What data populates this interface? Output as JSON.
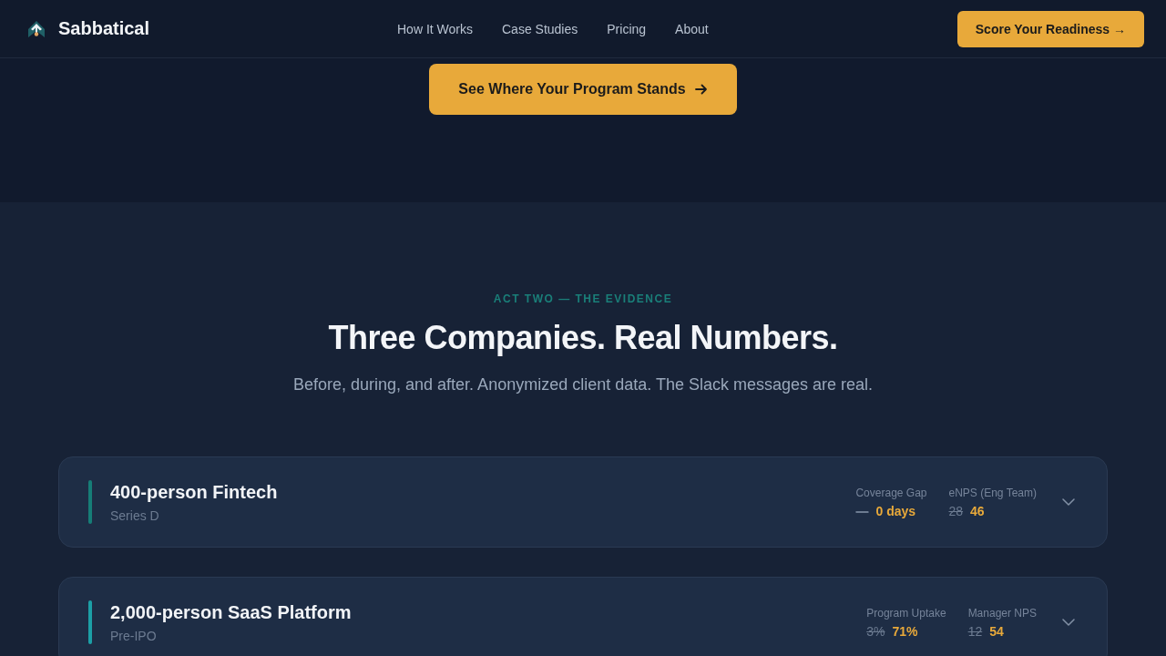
{
  "header": {
    "brand": "Sabbatical",
    "nav": [
      "How It Works",
      "Case Studies",
      "Pricing",
      "About"
    ],
    "cta": "Score Your Readiness →"
  },
  "hero": {
    "cta": "See Where Your Program Stands"
  },
  "evidence": {
    "eyebrow": "ACT TWO — THE EVIDENCE",
    "title": "Three Companies. Real Numbers.",
    "subtitle": "Before, during, and after. Anonymized client data. The Slack messages are real.",
    "cases": [
      {
        "title": "400-person Fintech",
        "stage": "Series D",
        "color": "#167d77",
        "expanded": false,
        "metrics": [
          {
            "label": "Coverage Gap",
            "before": "—",
            "after": "0 days"
          },
          {
            "label": "eNPS (Eng Team)",
            "before": "28",
            "after": "46"
          }
        ]
      },
      {
        "title": "2,000-person SaaS Platform",
        "stage": "Pre-IPO",
        "color": "#1c9fa6",
        "expanded": false,
        "metrics": [
          {
            "label": "Program Uptake",
            "before": "3%",
            "after": "71%"
          },
          {
            "label": "Manager NPS",
            "before": "12",
            "after": "54"
          }
        ]
      }
    ]
  }
}
